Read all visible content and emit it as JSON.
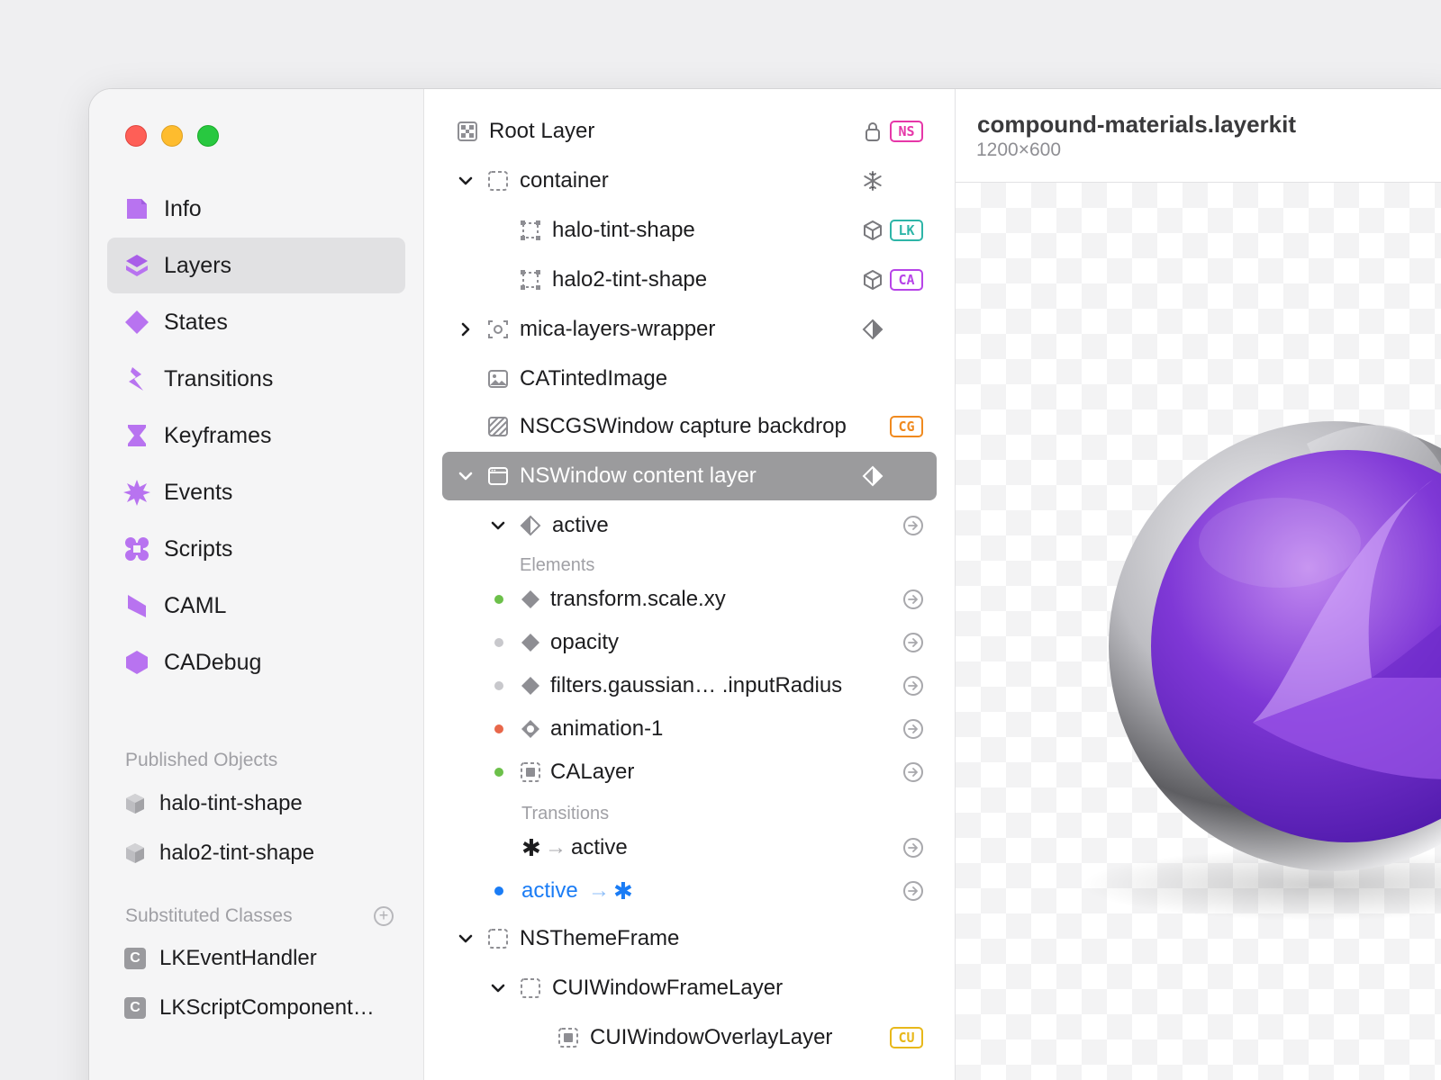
{
  "window": {
    "traffic_lights": [
      "close",
      "minimize",
      "zoom"
    ]
  },
  "sidebar": {
    "nav": [
      {
        "label": "Info",
        "icon": "info-icon",
        "selected": false
      },
      {
        "label": "Layers",
        "icon": "layers-icon",
        "selected": true
      },
      {
        "label": "States",
        "icon": "states-icon",
        "selected": false
      },
      {
        "label": "Transitions",
        "icon": "transitions-icon",
        "selected": false
      },
      {
        "label": "Keyframes",
        "icon": "keyframes-icon",
        "selected": false
      },
      {
        "label": "Events",
        "icon": "events-icon",
        "selected": false
      },
      {
        "label": "Scripts",
        "icon": "scripts-icon",
        "selected": false
      },
      {
        "label": "CAML",
        "icon": "caml-icon",
        "selected": false
      },
      {
        "label": "CADebug",
        "icon": "cadebug-icon",
        "selected": false
      }
    ],
    "published_title": "Published Objects",
    "published": [
      "halo-tint-shape",
      "halo2-tint-shape"
    ],
    "substituted_title": "Substituted Classes",
    "substituted": [
      "LKEventHandler",
      "LKScriptComponent…"
    ],
    "class_badge": "C",
    "accent": "#b873f0"
  },
  "tree": {
    "rows": [
      {
        "label": "Root Layer",
        "icon": "checker-icon",
        "right_icon": "lock-icon",
        "badge": "NS"
      },
      {
        "label": "container",
        "icon": "dashed-square-icon",
        "chevron": "down",
        "right_icon": "snowflake-icon"
      },
      {
        "label": "halo-tint-shape",
        "icon": "shape-icon",
        "right_icon": "cube-icon",
        "badge": "LK"
      },
      {
        "label": "halo2-tint-shape",
        "icon": "shape-icon",
        "right_icon": "cube-icon",
        "badge": "CA"
      },
      {
        "label": "mica-layers-wrapper",
        "icon": "focus-icon",
        "chevron": "right",
        "right_icon": "state-diamond-icon"
      },
      {
        "label": "CATintedImage",
        "icon": "image-icon"
      },
      {
        "label": "NSCGSWindow capture backdrop",
        "icon": "hatched-icon",
        "badge": "CG"
      },
      {
        "label": "NSWindow content layer",
        "icon": "window-icon",
        "chevron": "down",
        "right_icon": "state-diamond-icon",
        "selected": true
      },
      {
        "label": "active",
        "icon": "state-diamond-icon",
        "chevron": "down",
        "goto": true
      }
    ],
    "elements_title": "Elements",
    "elements": [
      {
        "label": "transform.scale.xy",
        "dot": "#6cc04a",
        "icon": "diamond-icon"
      },
      {
        "label": "opacity",
        "dot": "#c8c8cc",
        "icon": "diamond-icon"
      },
      {
        "label": "filters.gaussian… .inputRadius",
        "dot": "#c8c8cc",
        "icon": "diamond-icon"
      },
      {
        "label": "animation-1",
        "dot": "#e8674a",
        "icon": "animation-icon"
      },
      {
        "label": "CALayer",
        "dot": "#6cc04a",
        "icon": "layer-icon"
      }
    ],
    "transitions_title": "Transitions",
    "transitions": [
      {
        "from": "✱",
        "arrow": "→",
        "to": "active",
        "color": "#1d1d1f"
      },
      {
        "from": "active",
        "arrow": "→",
        "to": "✱",
        "color": "#1a7cf5",
        "dot": "#1a7cf5"
      }
    ],
    "bottom_rows": [
      {
        "label": "NSThemeFrame",
        "icon": "dashed-square-icon",
        "chevron": "down"
      },
      {
        "label": "CUIWindowFrameLayer",
        "icon": "dashed-square-icon",
        "chevron": "down"
      },
      {
        "label": "CUIWindowOverlayLayer",
        "icon": "layer-icon",
        "badge": "CU"
      }
    ],
    "badge_colors": {
      "NS": "#e637a8",
      "LK": "#2eb5a8",
      "CA": "#b744e8",
      "CG": "#f08a1f",
      "CU": "#e8b81a"
    }
  },
  "canvas": {
    "title": "compound-materials.layerkit",
    "size": "1200×600"
  }
}
